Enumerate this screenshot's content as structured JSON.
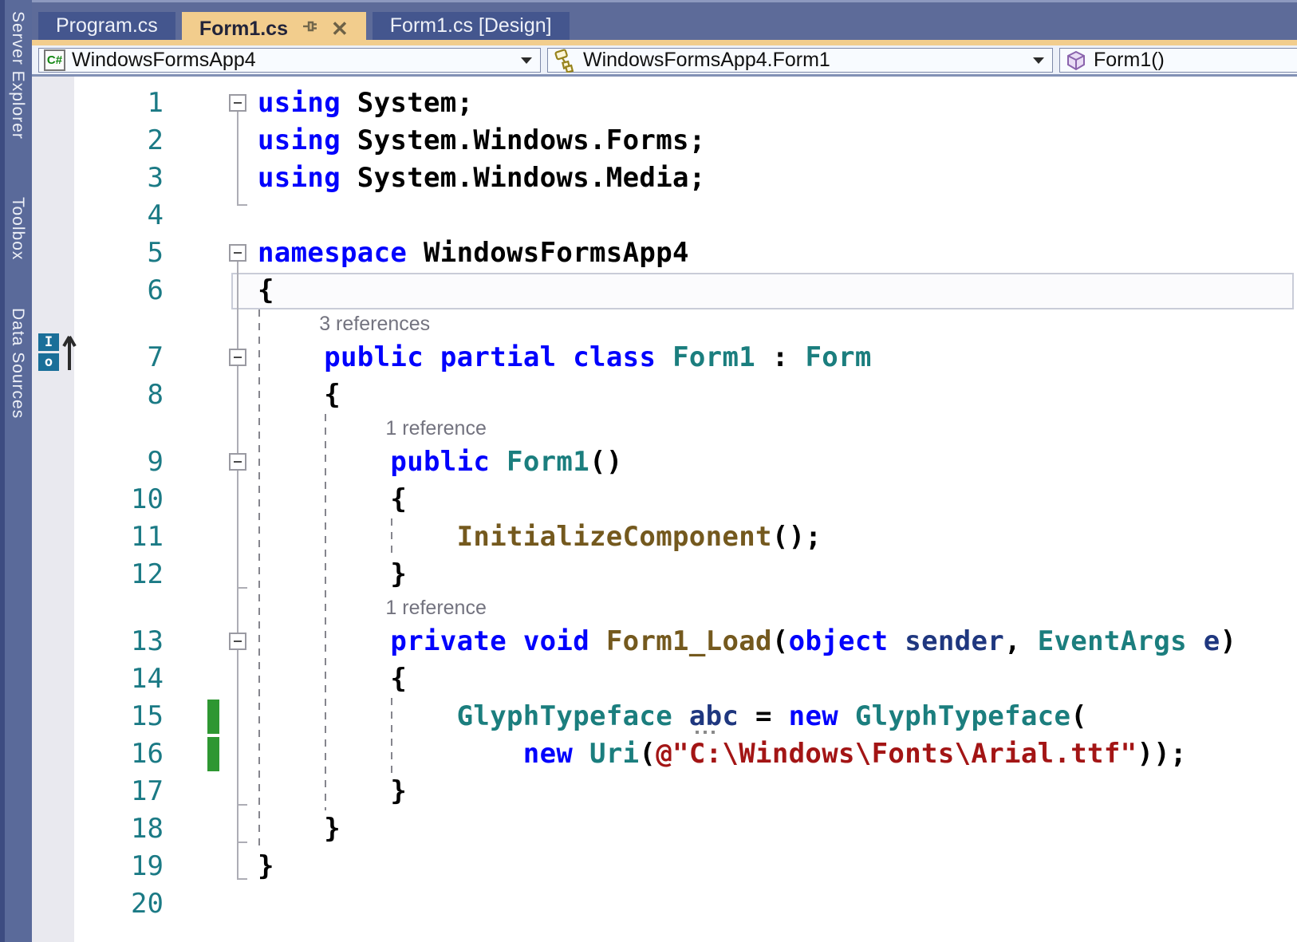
{
  "app": {
    "name": "Visual Studio code editor"
  },
  "colors": {
    "active_tab": "#f2cd8d",
    "inactive_tab": "#44568e",
    "tab_strip": "#5d6b99",
    "keyword": "#0101fd",
    "type": "#1b7e7e",
    "method": "#74591e",
    "string": "#a31515",
    "identifier": "#1f377f",
    "line_number": "#1b7a85",
    "change_bar_saved": "#2e9732"
  },
  "sidebar": {
    "items": [
      {
        "label": "Server Explorer"
      },
      {
        "label": "Toolbox"
      },
      {
        "label": "Data Sources"
      }
    ]
  },
  "tabs": {
    "tab1": {
      "label": "Program.cs"
    },
    "tab2": {
      "label": "Form1.cs",
      "close_glyph": "✕"
    },
    "tab3": {
      "label": "Form1.cs [Design]"
    }
  },
  "navbar": {
    "project": {
      "label": "WindowsFormsApp4",
      "icon": "csharp-project-icon",
      "icon_text": "C#"
    },
    "type": {
      "label": "WindowsFormsApp4.Form1",
      "icon": "class-icon"
    },
    "member": {
      "label": "Form1()",
      "icon": "method-icon"
    }
  },
  "gutter_icon": {
    "top": "I",
    "bottom": "o"
  },
  "editor": {
    "rows": [
      {
        "kind": "code",
        "n": "1",
        "fold": true,
        "tokens": [
          [
            "kw",
            "using"
          ],
          [
            "pl",
            " System;"
          ]
        ]
      },
      {
        "kind": "code",
        "n": "2",
        "tokens": [
          [
            "kw",
            "using"
          ],
          [
            "pl",
            " System.Windows.Forms;"
          ]
        ]
      },
      {
        "kind": "code",
        "n": "3",
        "tokens": [
          [
            "kw",
            "using"
          ],
          [
            "pl",
            " System.Windows.Media;"
          ]
        ]
      },
      {
        "kind": "code",
        "n": "4",
        "tokens": []
      },
      {
        "kind": "code",
        "n": "5",
        "fold": true,
        "tokens": [
          [
            "kw",
            "namespace"
          ],
          [
            "pl",
            " WindowsFormsApp4"
          ]
        ]
      },
      {
        "kind": "code",
        "n": "6",
        "current": true,
        "tokens": [
          [
            "pl",
            "{"
          ]
        ]
      },
      {
        "kind": "lens",
        "text": "3 references",
        "indent": 4
      },
      {
        "kind": "code",
        "n": "7",
        "fold": true,
        "tokens": [
          [
            "pl",
            "    "
          ],
          [
            "kw",
            "public"
          ],
          [
            "pl",
            " "
          ],
          [
            "kw",
            "partial"
          ],
          [
            "pl",
            " "
          ],
          [
            "kw",
            "class"
          ],
          [
            "pl",
            " "
          ],
          [
            "ty",
            "Form1"
          ],
          [
            "pl",
            " : "
          ],
          [
            "ty",
            "Form"
          ]
        ]
      },
      {
        "kind": "code",
        "n": "8",
        "tokens": [
          [
            "pl",
            "    {"
          ]
        ]
      },
      {
        "kind": "lens",
        "text": "1 reference",
        "indent": 8
      },
      {
        "kind": "code",
        "n": "9",
        "fold": true,
        "tokens": [
          [
            "pl",
            "        "
          ],
          [
            "kw",
            "public"
          ],
          [
            "pl",
            " "
          ],
          [
            "ty",
            "Form1"
          ],
          [
            "pl",
            "()"
          ]
        ]
      },
      {
        "kind": "code",
        "n": "10",
        "tokens": [
          [
            "pl",
            "        {"
          ]
        ]
      },
      {
        "kind": "code",
        "n": "11",
        "tokens": [
          [
            "pl",
            "            "
          ],
          [
            "me",
            "InitializeComponent"
          ],
          [
            "pl",
            "();"
          ]
        ]
      },
      {
        "kind": "code",
        "n": "12",
        "tokens": [
          [
            "pl",
            "        }"
          ]
        ]
      },
      {
        "kind": "lens",
        "text": "1 reference",
        "indent": 8
      },
      {
        "kind": "code",
        "n": "13",
        "fold": true,
        "tokens": [
          [
            "pl",
            "        "
          ],
          [
            "kw",
            "private"
          ],
          [
            "pl",
            " "
          ],
          [
            "kw",
            "void"
          ],
          [
            "pl",
            " "
          ],
          [
            "me",
            "Form1_Load"
          ],
          [
            "pl",
            "("
          ],
          [
            "kw",
            "object"
          ],
          [
            "pl",
            " "
          ],
          [
            "pm",
            "sender"
          ],
          [
            "pl",
            ", "
          ],
          [
            "ty",
            "EventArgs"
          ],
          [
            "pl",
            " "
          ],
          [
            "pm",
            "e"
          ],
          [
            "pl",
            ")"
          ]
        ]
      },
      {
        "kind": "code",
        "n": "14",
        "tokens": [
          [
            "pl",
            "        {"
          ]
        ]
      },
      {
        "kind": "code",
        "n": "15",
        "bar": true,
        "tokens": [
          [
            "pl",
            "            "
          ],
          [
            "ty",
            "GlyphTypeface"
          ],
          [
            "pl",
            " "
          ],
          [
            "lc",
            "abc"
          ],
          [
            "pl",
            " = "
          ],
          [
            "kw",
            "new"
          ],
          [
            "pl",
            " "
          ],
          [
            "ty",
            "GlyphTypeface"
          ],
          [
            "pl",
            "("
          ]
        ]
      },
      {
        "kind": "code",
        "n": "16",
        "bar": true,
        "tokens": [
          [
            "pl",
            "                "
          ],
          [
            "kw",
            "new"
          ],
          [
            "pl",
            " "
          ],
          [
            "ty",
            "Uri"
          ],
          [
            "pl",
            "("
          ],
          [
            "st",
            "@\"C:\\Windows\\Fonts\\Arial.ttf\""
          ],
          [
            "pl",
            "));"
          ]
        ]
      },
      {
        "kind": "code",
        "n": "17",
        "tokens": [
          [
            "pl",
            "        }"
          ]
        ]
      },
      {
        "kind": "code",
        "n": "18",
        "tokens": [
          [
            "pl",
            "    }"
          ]
        ]
      },
      {
        "kind": "code",
        "n": "19",
        "tokens": [
          [
            "pl",
            "}"
          ]
        ]
      },
      {
        "kind": "code",
        "n": "20",
        "tokens": []
      }
    ]
  }
}
